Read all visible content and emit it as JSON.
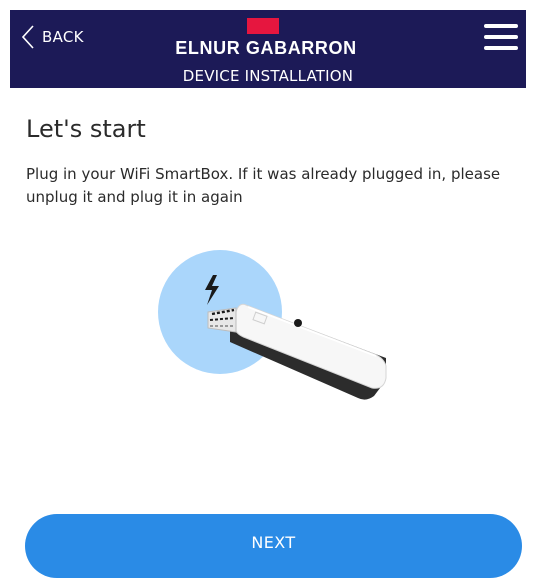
{
  "header": {
    "back_label": "BACK",
    "brand": "ELNUR GABARRON",
    "subtitle": "DEVICE INSTALLATION",
    "background_color": "#1c1a57",
    "brand_mark_color": "#e6163f",
    "back_icon": "chevron-left-icon",
    "menu_icon": "hamburger-menu-icon"
  },
  "main": {
    "title": "Let's start",
    "instructions": "Plug in your WiFi SmartBox. If it was already plugged in, please unplug it and plug it in again",
    "illustration_icon": "smartbox-plug-illustration"
  },
  "footer": {
    "next_label": "NEXT",
    "button_color": "#2a8be6"
  }
}
